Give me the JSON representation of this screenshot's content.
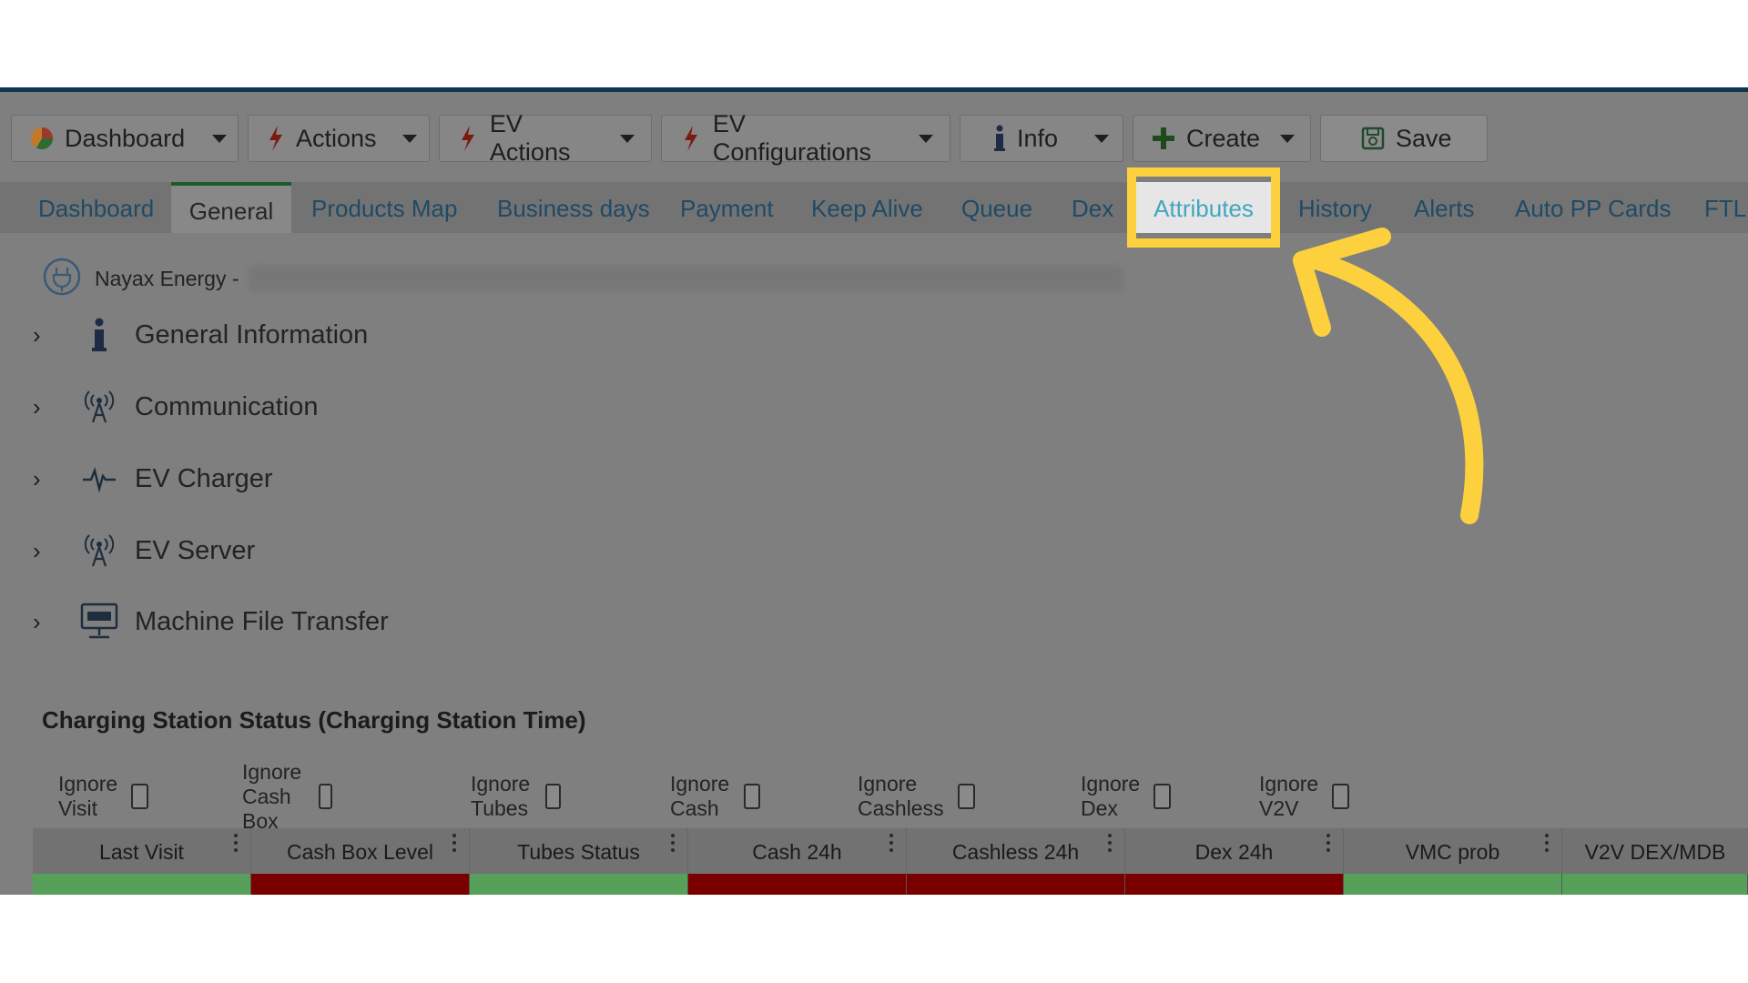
{
  "toolbar": {
    "buttons": [
      {
        "label": "Dashboard",
        "icon": "pie-chart-icon"
      },
      {
        "label": "Actions",
        "icon": "lightning-icon"
      },
      {
        "label": "EV Actions",
        "icon": "lightning-icon"
      },
      {
        "label": "EV Configurations",
        "icon": "lightning-icon"
      },
      {
        "label": "Info",
        "icon": "info-icon"
      },
      {
        "label": "Create",
        "icon": "plus-icon"
      }
    ],
    "save_label": "Save",
    "save_icon": "save-icon"
  },
  "tabs": [
    {
      "label": "Dashboard"
    },
    {
      "label": "General",
      "active": true
    },
    {
      "label": "Products Map"
    },
    {
      "label": "Business days"
    },
    {
      "label": "Payment"
    },
    {
      "label": "Keep Alive"
    },
    {
      "label": "Queue"
    },
    {
      "label": "Dex"
    },
    {
      "label": "Attributes",
      "highlighted": true
    },
    {
      "label": "History"
    },
    {
      "label": "Alerts"
    },
    {
      "label": "Auto PP Cards"
    },
    {
      "label": "FTL"
    }
  ],
  "device": {
    "label": "Nayax Energy -",
    "icon": "power-plug-icon"
  },
  "sections": [
    {
      "title": "General Information",
      "icon": "info-icon"
    },
    {
      "title": "Communication",
      "icon": "antenna-icon"
    },
    {
      "title": "EV Charger",
      "icon": "pulse-icon"
    },
    {
      "title": "EV Server",
      "icon": "antenna-icon"
    },
    {
      "title": "Machine File Transfer",
      "icon": "ftp-monitor-icon"
    }
  ],
  "status": {
    "title": "Charging Station Status (Charging Station Time)",
    "ignore_options": [
      "Ignore Visit",
      "Ignore Cash Box",
      "Ignore Tubes",
      "Ignore Cash",
      "Ignore Cashless",
      "Ignore Dex",
      "Ignore V2V"
    ],
    "columns": [
      "Last Visit",
      "Cash Box Level",
      "Tubes Status",
      "Cash 24h",
      "Cashless 24h",
      "Dex 24h",
      "VMC prob",
      "V2V DEX/MDB"
    ],
    "row_status_colors": [
      "#57a05a",
      "#7a0000",
      "#57a05a",
      "#7a0000",
      "#7a0000",
      "#7a0000",
      "#57a05a",
      "#57a05a"
    ]
  },
  "colors": {
    "highlight": "#fdd13e",
    "overlay": "#7f7f7f",
    "link": "#1f4a66"
  }
}
